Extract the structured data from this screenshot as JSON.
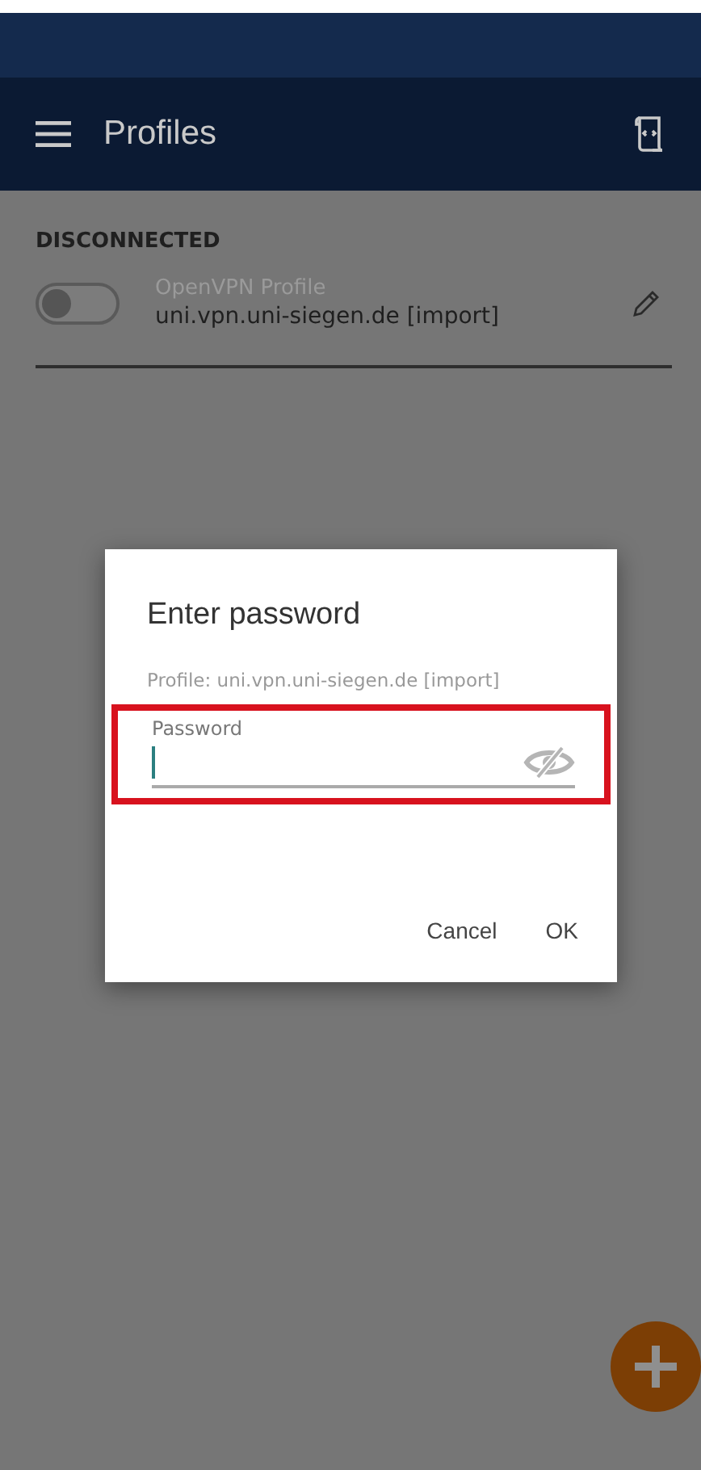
{
  "app_bar": {
    "title": "Profiles"
  },
  "section": {
    "header": "DISCONNECTED"
  },
  "profiles": [
    {
      "type": "OpenVPN Profile",
      "name": "uni.vpn.uni-siegen.de [import]",
      "on": false
    }
  ],
  "dialog": {
    "title": "Enter password",
    "message": "Profile: uni.vpn.uni-siegen.de [import]",
    "field": {
      "label": "Password",
      "highlighted": true
    },
    "buttons": [
      "Cancel",
      "OK"
    ]
  }
}
